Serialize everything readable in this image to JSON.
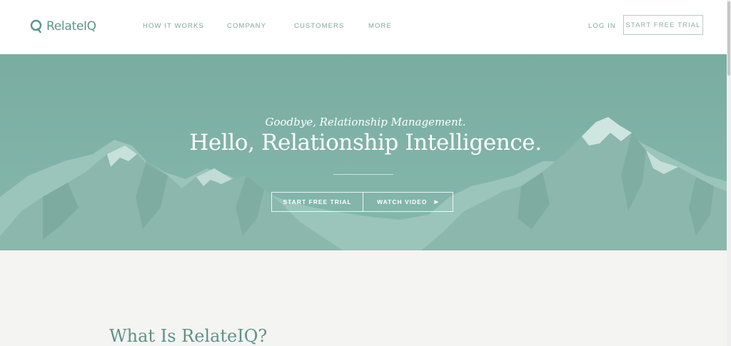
{
  "brand": {
    "name": "RelateIQ"
  },
  "nav": {
    "items": [
      "HOW IT WORKS",
      "COMPANY",
      "CUSTOMERS",
      "MORE"
    ],
    "login": "LOG IN",
    "cta": "START FREE TRIAL"
  },
  "hero": {
    "kicker": "Goodbye, Relationship Management.",
    "title": "Hello, Relationship Intelligence.",
    "primary_cta": "START FREE TRIAL",
    "secondary_cta": "WATCH VIDEO",
    "play_icon": "chevron-right-icon"
  },
  "section": {
    "title": "What Is RelateIQ?"
  },
  "colors": {
    "brand": "#5c9585",
    "hero_bg": "#7fb0a5",
    "page_bg": "#f4f4f2"
  }
}
